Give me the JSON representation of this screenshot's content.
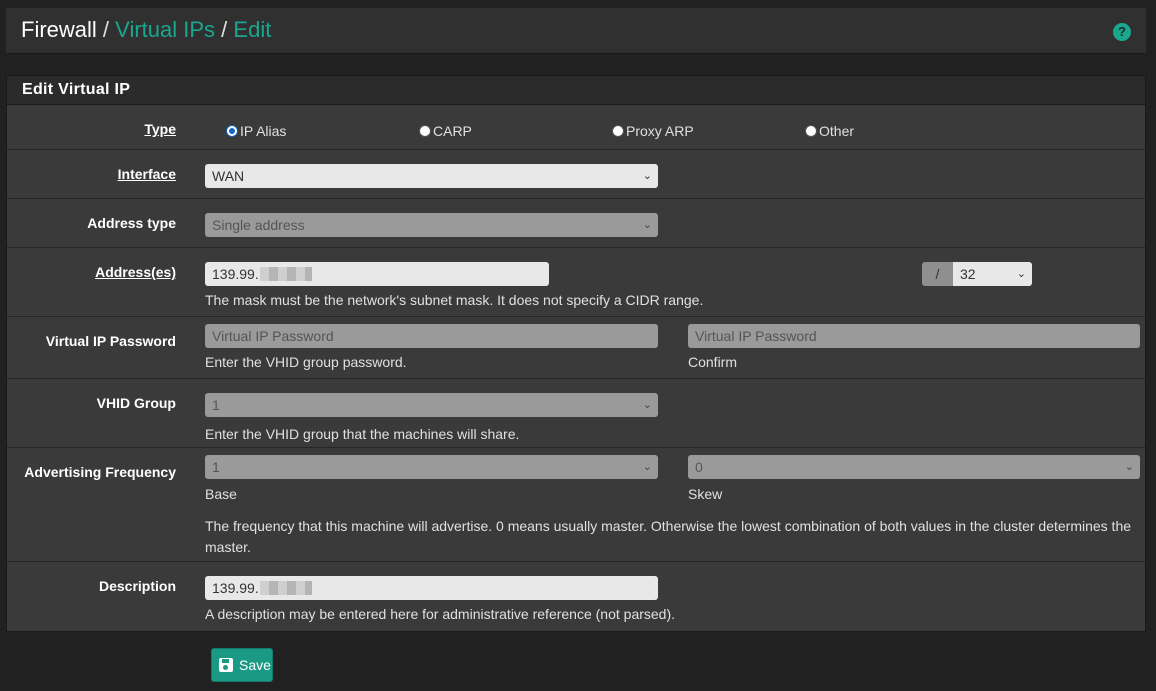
{
  "breadcrumb": {
    "root": "Firewall",
    "sep": "/",
    "virtual_ips": "Virtual IPs",
    "edit": "Edit"
  },
  "help_icon": "?",
  "panel": {
    "title": "Edit Virtual IP"
  },
  "type": {
    "label": "Type",
    "options": [
      {
        "label": "IP Alias",
        "selected": true
      },
      {
        "label": "CARP",
        "selected": false
      },
      {
        "label": "Proxy ARP",
        "selected": false
      },
      {
        "label": "Other",
        "selected": false
      }
    ]
  },
  "interface": {
    "label": "Interface",
    "value": "WAN"
  },
  "address_type": {
    "label": "Address type",
    "value": "Single address"
  },
  "address": {
    "label": "Address(es)",
    "value": "139.99.",
    "slash": "/",
    "mask": "32",
    "help": "The mask must be the network's subnet mask. It does not specify a CIDR range."
  },
  "vip_password": {
    "label": "Virtual IP Password",
    "placeholder": "Virtual IP Password",
    "confirm_placeholder": "Virtual IP Password",
    "help": "Enter the VHID group password.",
    "confirm_help": "Confirm"
  },
  "vhid": {
    "label": "VHID Group",
    "value": "1",
    "help": "Enter the VHID group that the machines will share."
  },
  "adv_freq": {
    "label": "Advertising Frequency",
    "base": "1",
    "base_label": "Base",
    "skew": "0",
    "skew_label": "Skew",
    "help_line1": "The frequency that this machine will advertise. 0 means usually master. Otherwise the lowest combination of both values in the cluster determines the",
    "help_line2": "master."
  },
  "description": {
    "label": "Description",
    "value": "139.99.",
    "help": "A description may be entered here for administrative reference (not parsed)."
  },
  "save_button": {
    "label": "Save"
  },
  "icons": {
    "select": "chevron-down-icon",
    "save": "floppy-disk-icon",
    "help": "question-circle-icon"
  },
  "colors": {
    "accent": "#1aa78f",
    "background": "#212121",
    "panel": "#3a3a3a",
    "button": "#1a9a85"
  }
}
